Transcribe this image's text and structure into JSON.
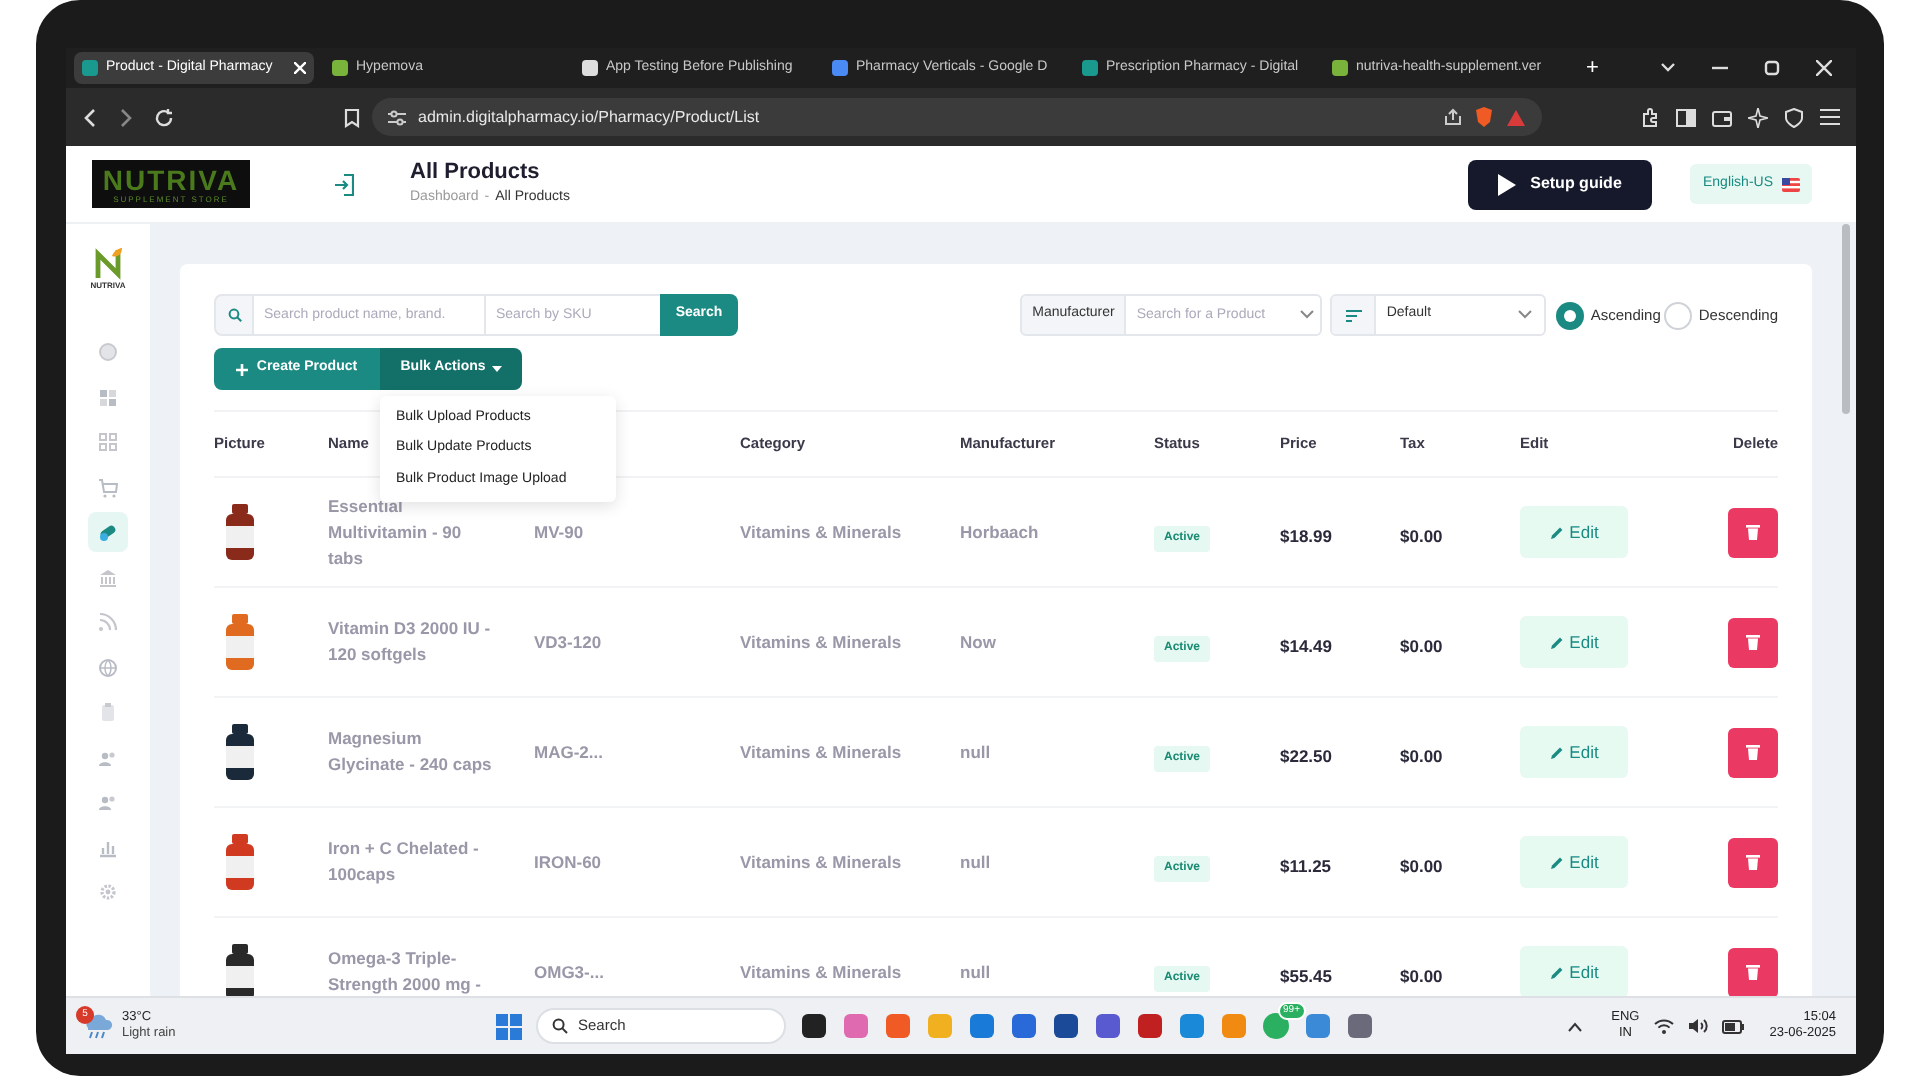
{
  "browser": {
    "tabs": [
      {
        "title": "Product - Digital Pharmacy",
        "selected": true
      },
      {
        "title": "Hypemova",
        "selected": false
      },
      {
        "title": "App Testing Before Publishing",
        "selected": false
      },
      {
        "title": "Pharmacy Verticals - Google D",
        "selected": false
      },
      {
        "title": "Prescription Pharmacy - Digital",
        "selected": false
      },
      {
        "title": "nutriva-health-supplement.ver",
        "selected": false
      }
    ],
    "new_tab": "+",
    "url": "admin.digitalpharmacy.io/Pharmacy/Product/List"
  },
  "header": {
    "logo": {
      "name": "NUTRIVA",
      "tagline": "SUPPLEMENT STORE"
    },
    "title": "All Products",
    "breadcrumb": [
      "Dashboard",
      "All Products"
    ],
    "breadcrumb_separator": "-",
    "setup_button": "Setup guide",
    "language": "English-US"
  },
  "sidebar": {
    "logo": "NUTRIVA",
    "items": [
      {
        "selected": false
      },
      {
        "selected": false
      },
      {
        "selected": false
      },
      {
        "selected": false
      },
      {
        "selected": true
      },
      {
        "selected": false
      },
      {
        "selected": false
      },
      {
        "selected": false
      },
      {
        "selected": false
      },
      {
        "selected": false
      },
      {
        "selected": false
      },
      {
        "selected": false
      },
      {
        "selected": false
      }
    ]
  },
  "toolbar": {
    "search_placeholder": "Search product name, brand.",
    "sku_placeholder": "Search by SKU",
    "search_button": "Search",
    "manufacturer_label": "Manufacturer",
    "manufacturer_placeholder": "Search for a Product",
    "sort": "Default",
    "order": [
      {
        "label": "Ascending",
        "selected": true
      },
      {
        "label": "Descending",
        "selected": false
      }
    ],
    "create_button": "Create Product",
    "bulk_button": "Bulk Actions"
  },
  "bulk_menu": [
    "Bulk Upload Products",
    "Bulk Update Products",
    "Bulk Product Image Upload"
  ],
  "table": {
    "columns": [
      "Picture",
      "Name",
      "Category",
      "Manufacturer",
      "Status",
      "Price",
      "Tax",
      "Edit",
      "Delete"
    ],
    "rows": [
      {
        "name": "Essential Multivitamin - 90 tabs",
        "sku": "MV-90",
        "category": "Vitamins & Minerals",
        "manufacturer": "Horbaach",
        "status": "Active",
        "price": "$18.99",
        "tax": "$0.00",
        "edit": "Edit"
      },
      {
        "name": "Vitamin D3 2000 IU - 120 softgels",
        "sku": "VD3-120",
        "category": "Vitamins & Minerals",
        "manufacturer": "Now",
        "status": "Active",
        "price": "$14.49",
        "tax": "$0.00",
        "edit": "Edit"
      },
      {
        "name": "Magnesium Glycinate - 240 caps",
        "sku": "MAG-2...",
        "category": "Vitamins & Minerals",
        "manufacturer": "null",
        "status": "Active",
        "price": "$22.50",
        "tax": "$0.00",
        "edit": "Edit"
      },
      {
        "name": "Iron + C Chelated - 100caps",
        "sku": "IRON-60",
        "category": "Vitamins & Minerals",
        "manufacturer": "null",
        "status": "Active",
        "price": "$11.25",
        "tax": "$0.00",
        "edit": "Edit"
      },
      {
        "name": "Omega-3 Triple-Strength 2000 mg -",
        "sku": "OMG3-...",
        "category": "Vitamins & Minerals",
        "manufacturer": "null",
        "status": "Active",
        "price": "$55.45",
        "tax": "$0.00",
        "edit": "Edit"
      }
    ]
  },
  "taskbar": {
    "weather": {
      "badge": "5",
      "temperature": "33°C",
      "condition": "Light rain"
    },
    "search": "Search",
    "chat_badge": "99+",
    "language": [
      "ENG",
      "IN"
    ],
    "time": "15:04",
    "date": "23-06-2025"
  }
}
